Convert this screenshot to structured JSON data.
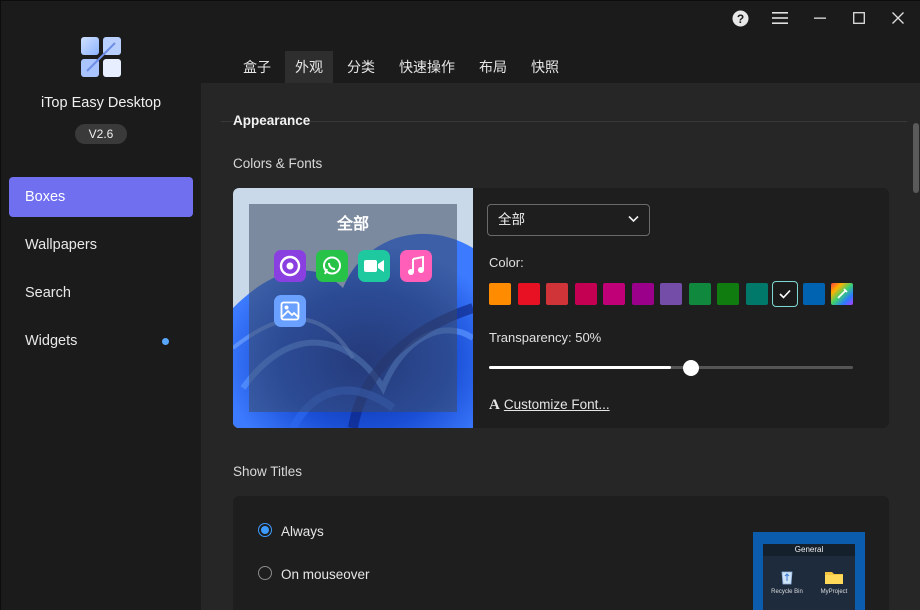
{
  "app": {
    "name": "iTop Easy Desktop",
    "version": "V2.6"
  },
  "sidebar": {
    "items": [
      {
        "label": "Boxes"
      },
      {
        "label": "Wallpapers"
      },
      {
        "label": "Search"
      },
      {
        "label": "Widgets"
      }
    ]
  },
  "tabs": [
    {
      "label": "盒子"
    },
    {
      "label": "外观"
    },
    {
      "label": "分类"
    },
    {
      "label": "快速操作"
    },
    {
      "label": "布局"
    },
    {
      "label": "快照"
    }
  ],
  "appearance": {
    "title": "Appearance",
    "colors_fonts_label": "Colors & Fonts",
    "preview_title": "全部",
    "dropdown_value": "全部",
    "color_label": "Color:",
    "swatches": [
      "#ff8c00",
      "#e81123",
      "#d13438",
      "#c30052",
      "#bf0077",
      "#9a0089",
      "#744da9",
      "#10893e",
      "#107c10",
      "#00796b",
      "#1a1a1a",
      "#0063b1",
      "rainbow"
    ],
    "transparency_label": "Transparency: 50%",
    "transparency_value": 0.5,
    "customize_font_label": "Customize Font...",
    "show_titles_label": "Show Titles",
    "options": [
      {
        "label": "Always",
        "selected": true
      },
      {
        "label": "On mouseover",
        "selected": false
      }
    ],
    "mini_preview": {
      "title": "General",
      "items": [
        "Recycle Bin",
        "MyProject"
      ]
    }
  },
  "colors": {
    "accent": "#6f6ff0",
    "sidebar_bg": "#1b1b1b",
    "content_bg": "#262626"
  },
  "icons": [
    "help-icon",
    "menu-icon",
    "minimize-icon",
    "maximize-icon",
    "close-icon",
    "chrome-icon",
    "whatsapp-icon",
    "facetime-icon",
    "music-icon",
    "photos-icon",
    "recycle-bin-icon",
    "folder-icon"
  ]
}
